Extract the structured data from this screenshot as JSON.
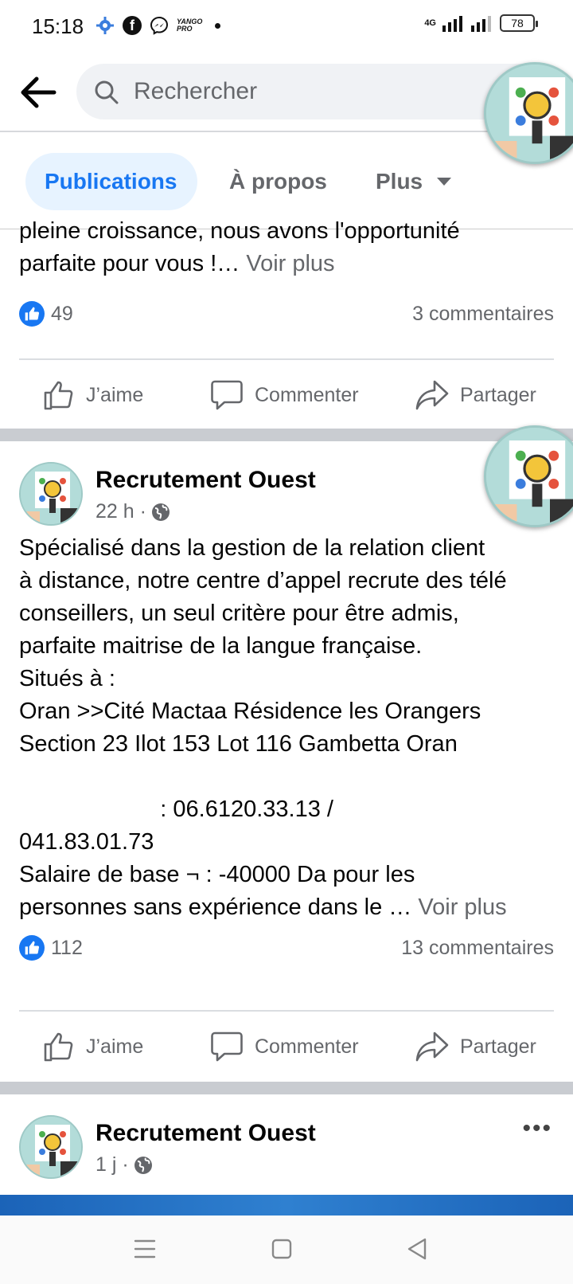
{
  "status_bar": {
    "time": "15:18",
    "network": "4G",
    "battery": "78",
    "yango_label": "YANGO PRO"
  },
  "search": {
    "placeholder": "Rechercher"
  },
  "tabs": [
    {
      "label": "Publications",
      "active": true
    },
    {
      "label": "À propos",
      "active": false
    },
    {
      "label": "Plus",
      "active": false
    }
  ],
  "post1": {
    "text_partial": "pleine croissance, nous avons l'opportunité\nparfaite pour vous !…",
    "see_more": "Voir plus",
    "likes": "49",
    "comments": "3 commentaires"
  },
  "actions": {
    "like": "J’aime",
    "comment": "Commenter",
    "share": "Partager"
  },
  "post2": {
    "author": "Recrutement Ouest",
    "time": "22 h ·",
    "text": "Spécialisé dans la gestion de la relation client\nà distance, notre centre d’appel recrute des télé\nconseillers, un seul critère pour être admis,\nparfaite maitrise de la langue française.\nSitués à :\nOran >>Cité Mactaa Résidence les Orangers\nSection 23 Ilot 153 Lot 116 Gambetta Oran\n\n                      : 06.6120.33.13 /\n041.83.01.73\nSalaire de base ¬ : -40000 Da pour les\npersonnes sans expérience dans le …",
    "see_more": "Voir plus",
    "likes": "112",
    "comments": "13 commentaires"
  },
  "post3": {
    "author": "Recrutement Ouest",
    "time": "1 j ·",
    "more": "•••"
  },
  "colors": {
    "accent": "#1877f2",
    "tab_active_bg": "#e7f3ff",
    "secondary_text": "#65676b",
    "separator": "#c9ccd1"
  },
  "icons": {
    "back": "arrow-left-icon",
    "search": "search-icon",
    "like": "thumbs-up-icon",
    "comment": "speech-bubble-icon",
    "share": "share-arrow-icon",
    "globe": "globe-icon",
    "nav_menu": "menu-icon",
    "nav_home": "square-icon",
    "nav_back": "triangle-back-icon"
  }
}
